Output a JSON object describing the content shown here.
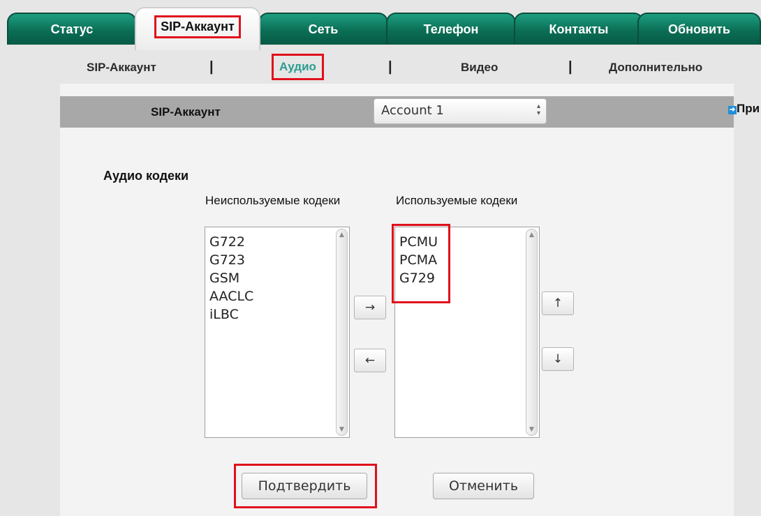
{
  "tabs": [
    {
      "label": "Статус"
    },
    {
      "label": "SIP-Аккаунт"
    },
    {
      "label": "Сеть"
    },
    {
      "label": "Телефон"
    },
    {
      "label": "Контакты"
    },
    {
      "label": "Обновить"
    }
  ],
  "active_tab": "SIP-Аккаунт",
  "subtabs": [
    {
      "label": "SIP-Аккаунт"
    },
    {
      "label": "Аудио"
    },
    {
      "label": "Видео"
    },
    {
      "label": "Дополнительно"
    }
  ],
  "active_subtab": "Аудио",
  "subtab_separator": "|",
  "account": {
    "label": "SIP-Аккаунт",
    "selected": "Account 1"
  },
  "side_link": "При",
  "codecs": {
    "title": "Аудио кодеки",
    "unused_title": "Неиспользуемые кодеки",
    "used_title": "Используемые кодеки",
    "unused": [
      "G722",
      "G723",
      "GSM",
      "AACLC",
      "iLBC"
    ],
    "used": [
      "PCMU",
      "PCMA",
      "G729"
    ]
  },
  "move_buttons": {
    "right": "→",
    "left": "←",
    "up": "↑",
    "down": "↓"
  },
  "buttons": {
    "confirm": "Подтвердить",
    "cancel": "Отменить"
  },
  "colors": {
    "tab_green": "#0b6e55",
    "highlight_red": "#e0101c",
    "active_subtab": "#2a9d8f",
    "account_bar": "#a8a8a8"
  }
}
